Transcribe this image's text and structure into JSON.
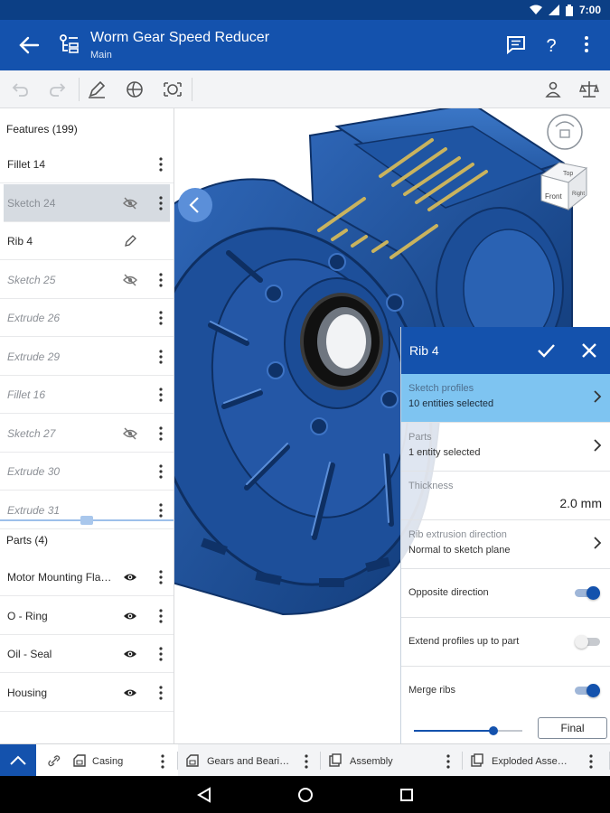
{
  "status_bar": {
    "time": "7:00"
  },
  "app_bar": {
    "title": "Worm Gear Speed Reducer",
    "subtitle": "Main"
  },
  "colors": {
    "primary": "#1452ad",
    "status": "#0c3f85",
    "part_blue": "#1a4f9c",
    "sketch": "#c9b35e",
    "selection": "#7ec4f1"
  },
  "features": {
    "header": "Features (199)",
    "items": [
      {
        "label": "Fillet 14",
        "state": "normal",
        "icon": "kebab-icon"
      },
      {
        "label": "Sketch 24",
        "state": "selected-hidden",
        "icon": "eye-off-icon"
      },
      {
        "label": "Rib 4",
        "state": "editing",
        "icon": "pencil-icon"
      },
      {
        "label": "Sketch 25",
        "state": "dim-hidden",
        "icon": "eye-off-icon"
      },
      {
        "label": "Extrude 26",
        "state": "dim",
        "icon": "kebab-icon"
      },
      {
        "label": "Extrude 29",
        "state": "dim",
        "icon": "kebab-icon"
      },
      {
        "label": "Fillet 16",
        "state": "dim",
        "icon": "kebab-icon"
      },
      {
        "label": "Sketch 27",
        "state": "dim-hidden",
        "icon": "eye-off-icon"
      },
      {
        "label": "Extrude 30",
        "state": "dim",
        "icon": "kebab-icon"
      },
      {
        "label": "Extrude 31",
        "state": "dim",
        "icon": "kebab-icon"
      }
    ]
  },
  "parts": {
    "header": "Parts (4)",
    "items": [
      {
        "label": "Motor Mounting Fla…"
      },
      {
        "label": "O - Ring"
      },
      {
        "label": "Oil - Seal"
      },
      {
        "label": "Housing"
      }
    ]
  },
  "view_cube": {
    "top": "Top",
    "front": "Front",
    "right": "Right"
  },
  "rib_panel": {
    "title": "Rib 4",
    "sketch_profiles_label": "Sketch profiles",
    "sketch_profiles_value": "10 entities selected",
    "parts_label": "Parts",
    "parts_value": "1 entity selected",
    "thickness_label": "Thickness",
    "thickness_value": "2.0 mm",
    "direction_label": "Rib extrusion direction",
    "direction_value": "Normal to sketch plane",
    "opposite_label": "Opposite direction",
    "opposite_on": true,
    "extend_label": "Extend profiles up to part",
    "extend_on": false,
    "merge_label": "Merge ribs",
    "merge_on": true,
    "slider_fraction": 0.73,
    "final_label": "Final"
  },
  "tabs": [
    {
      "label": "Casing",
      "icon": "part-studio-icon",
      "active": true
    },
    {
      "label": "Gears and Beari…",
      "icon": "part-studio-icon",
      "active": false
    },
    {
      "label": "Assembly",
      "icon": "assembly-icon",
      "active": false
    },
    {
      "label": "Exploded Asse…",
      "icon": "assembly-icon",
      "active": false
    }
  ]
}
